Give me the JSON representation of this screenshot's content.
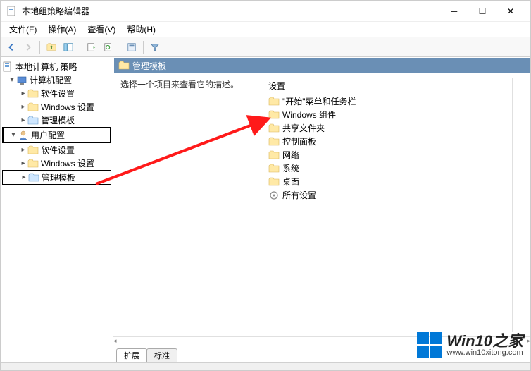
{
  "window": {
    "title": "本地组策略编辑器"
  },
  "menu": {
    "file": "文件(F)",
    "action": "操作(A)",
    "view": "查看(V)",
    "help": "帮助(H)"
  },
  "tree": {
    "root": "本地计算机 策略",
    "computer": "计算机配置",
    "cc_soft": "软件设置",
    "cc_win": "Windows 设置",
    "cc_admin": "管理模板",
    "user": "用户配置",
    "uc_soft": "软件设置",
    "uc_win": "Windows 设置",
    "uc_admin": "管理模板"
  },
  "content": {
    "header": "管理模板",
    "desc": "选择一个项目来查看它的描述。",
    "settings_label": "设置",
    "items": [
      "\"开始\"菜单和任务栏",
      "Windows 组件",
      "共享文件夹",
      "控制面板",
      "网络",
      "系统",
      "桌面",
      "所有设置"
    ]
  },
  "tabs": {
    "extended": "扩展",
    "standard": "标准"
  },
  "watermark": {
    "brand": "Win10",
    "suffix": "之家",
    "url": "www.win10xitong.com"
  }
}
